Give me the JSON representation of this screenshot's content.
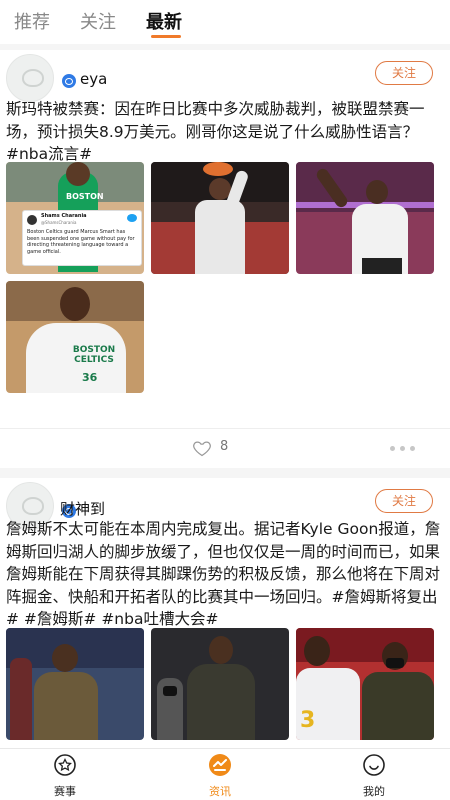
{
  "tabs": [
    {
      "label": "推荐"
    },
    {
      "label": "关注"
    },
    {
      "label": "最新",
      "active": true
    }
  ],
  "posts": [
    {
      "username": "eya",
      "follow_label": "关注",
      "text": "斯玛特被禁赛：因在昨日比赛中多次威胁裁判，被联盟禁赛一场，预计损失8.9万美元。刚哥你这是说了什么威胁性语言？#nba流言#",
      "images": [
        {
          "jersey_text": "BOSTON",
          "tweet_name": "Shams Charania",
          "tweet_handle": "@ShamsCharania",
          "tweet_text": "Boston Celtics guard Marcus Smart has been suspended one game without pay for directing threatening language toward a game official."
        },
        {
          "jersey_text": ""
        },
        {
          "jersey_text": ""
        },
        {
          "jersey_text": "BOSTON CELTICS",
          "jersey_number": "36"
        }
      ],
      "likes": "8"
    },
    {
      "username": "财神到",
      "follow_label": "关注",
      "text": "詹姆斯不太可能在本周内完成复出。据记者Kyle Goon报道，詹姆斯回归湖人的脚步放缓了，但也仅仅是一周的时间而已，如果詹姆斯能在下周获得其脚踝伤势的积极反馈，那么他将在下周对阵掘金、快船和开拓者队的比赛其中一场回归。#詹姆斯将复出# #詹姆斯# #nba吐槽大会#",
      "images": [
        {
          "jersey_text": ""
        },
        {
          "jersey_text": ""
        },
        {
          "jersey_text": "3"
        }
      ]
    }
  ],
  "bottom_nav": [
    {
      "label": "赛事",
      "icon": "star-circle-icon"
    },
    {
      "label": "资讯",
      "icon": "news-flame-icon",
      "active": true
    },
    {
      "label": "我的",
      "icon": "smile-face-icon"
    }
  ],
  "colors": {
    "accent": "#f07a2a",
    "follow": "#e07a44",
    "badge": "#2f7ae5",
    "active_nav": "#f08a18"
  }
}
